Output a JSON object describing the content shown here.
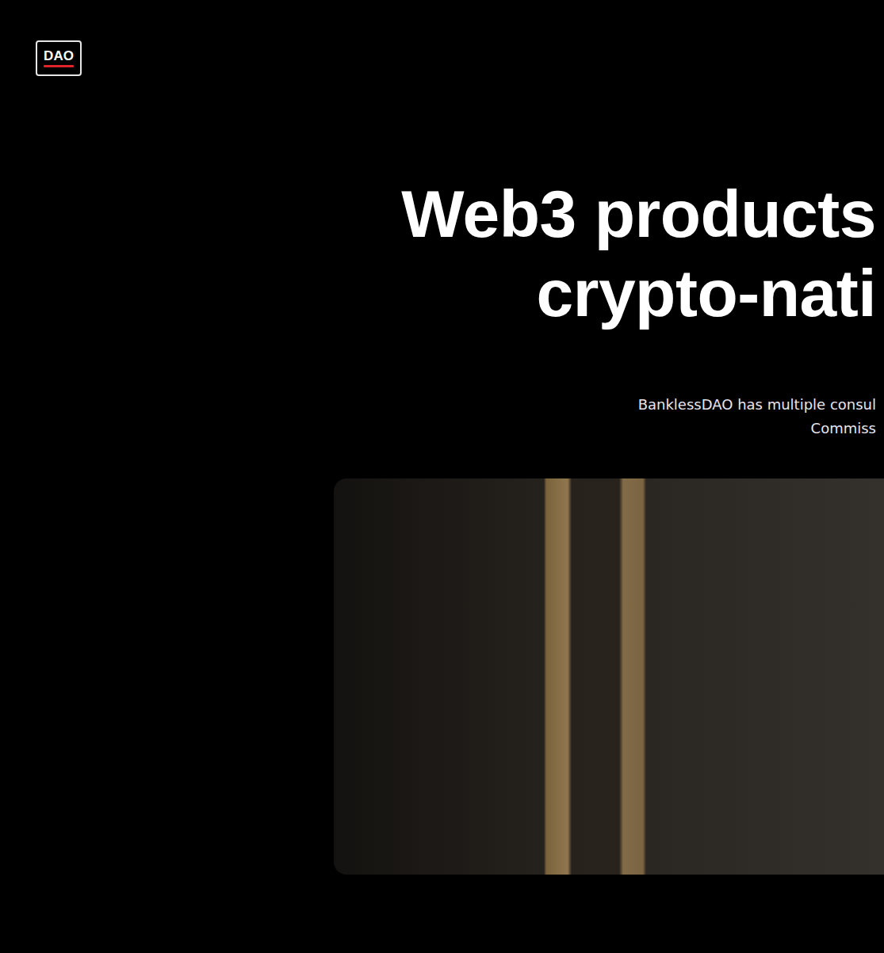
{
  "logo": {
    "text": "DAO"
  },
  "hero": {
    "heading": [
      "Web3 products",
      "crypto-nati"
    ],
    "subtitle": [
      "BanklessDAO has multiple consul",
      "Commiss"
    ]
  }
}
